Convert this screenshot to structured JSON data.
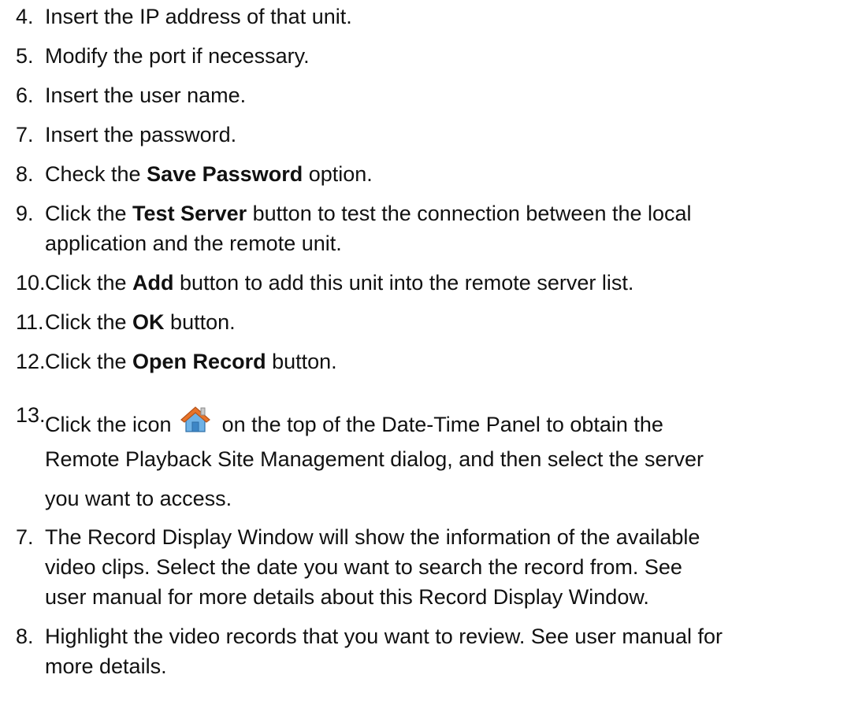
{
  "steps": [
    {
      "num": "4.",
      "text": "Insert the IP address of that unit."
    },
    {
      "num": "5.",
      "text": "Modify the port if necessary."
    },
    {
      "num": "6.",
      "text": "Insert the user name."
    },
    {
      "num": "7.",
      "text": "Insert the password."
    },
    {
      "num": "8.",
      "pre": "Check the ",
      "bold": "Save Password",
      "post": " option."
    },
    {
      "num": "9.",
      "pre": "Click the ",
      "bold": "Test Server",
      "post": " button to test the connection between the local",
      "line2": "application and the remote unit."
    },
    {
      "num": "10.",
      "pre": "Click the ",
      "bold": "Add",
      "post": " button to add this unit into the remote server list."
    },
    {
      "num": "11.",
      "pre": "Click the ",
      "bold": "OK",
      "post": " button."
    },
    {
      "num": "12.",
      "pre": "Click the ",
      "bold": "Open Record",
      "post": " button."
    },
    {
      "num": "13.",
      "pre": "Click the icon",
      "post": "on the top of the Date-Time Panel to obtain the",
      "icon": "home-icon",
      "line2": "Remote Playback Site Management dialog, and then select the server",
      "line3": "you want to access."
    },
    {
      "num": "7.",
      "text": "The Record Display Window will show the information of the available",
      "line2": "video clips. Select the date you want to search the record from. See",
      "line3": "user manual for more details about this Record Display Window."
    },
    {
      "num": "8.",
      "text": "Highlight the video records that you want to review. See user manual for",
      "line2": "more details."
    }
  ],
  "colors": {
    "text": "#111111",
    "icon_roof": "#e8742a",
    "icon_wall": "#6fb2e6"
  }
}
